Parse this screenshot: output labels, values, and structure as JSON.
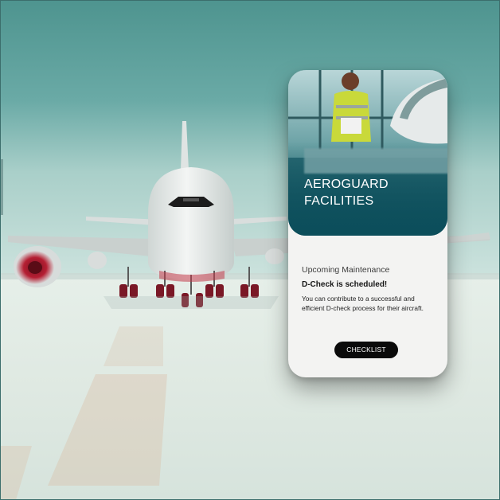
{
  "card": {
    "title_line1": "AEROGUARD",
    "title_line2": "FACILITIES",
    "section_label": "Upcoming Maintenance",
    "headline": "D-Check is scheduled!",
    "body": "You can contribute to a successful and efficient D-check process for their aircraft.",
    "button_label": "CHECKLIST"
  },
  "colors": {
    "sky": "#5fa39f",
    "card_header": "#0c4e5b",
    "card_background": "#f3f3f2",
    "button": "#0a0a0a"
  }
}
